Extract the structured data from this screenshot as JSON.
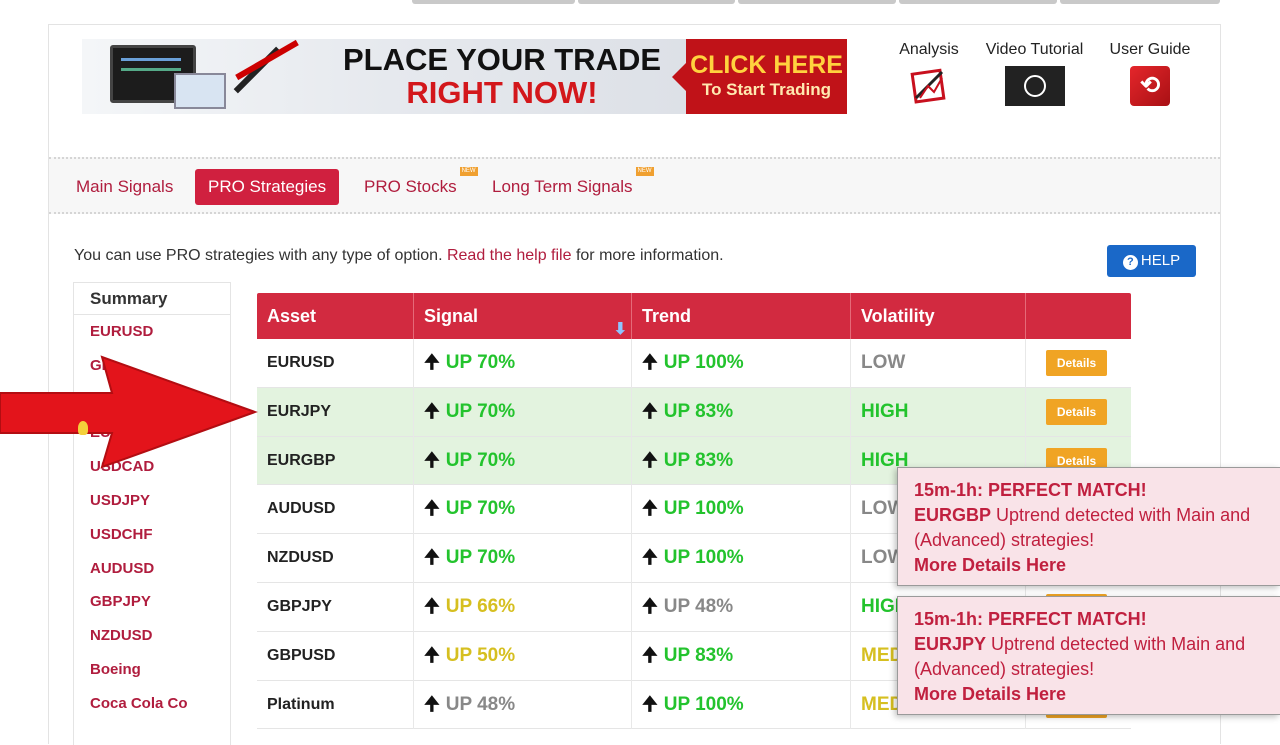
{
  "banner": {
    "headline_1": "PLACE YOUR TRADE",
    "headline_2": "RIGHT NOW!",
    "cta_1": "CLICK HERE",
    "cta_2": "To Start Trading"
  },
  "tools": {
    "analysis": "Analysis",
    "video": "Video Tutorial",
    "guide": "User Guide"
  },
  "tabs": [
    {
      "label": "Main Signals",
      "new": ""
    },
    {
      "label": "PRO Strategies",
      "new": ""
    },
    {
      "label": "PRO Stocks",
      "new": "NEW"
    },
    {
      "label": "Long Term Signals",
      "new": "NEW"
    }
  ],
  "info": {
    "text_before": "You can use PRO strategies with any type of option. ",
    "link": "Read the help file",
    "text_after": " for more information."
  },
  "help_label": "HELP",
  "sidebar": {
    "summary": "Summary",
    "items": [
      "EURUSD",
      "GB",
      "",
      "EUR",
      "USDCAD",
      "USDJPY",
      "USDCHF",
      "AUDUSD",
      "GBPJPY",
      "NZDUSD",
      "Boeing",
      "Coca Cola Co"
    ]
  },
  "table": {
    "headers": [
      "Asset",
      "Signal",
      "Trend",
      "Volatility",
      ""
    ],
    "details_label": "Details",
    "rows": [
      {
        "asset": "EURUSD",
        "signal": "UP 70%",
        "signal_color": "green",
        "trend": "UP 100%",
        "trend_color": "green",
        "vol": "LOW",
        "vol_color": "grey",
        "highlight": false
      },
      {
        "asset": "EURJPY",
        "signal": "UP 70%",
        "signal_color": "green",
        "trend": "UP 83%",
        "trend_color": "green",
        "vol": "HIGH",
        "vol_color": "green",
        "highlight": true
      },
      {
        "asset": "EURGBP",
        "signal": "UP 70%",
        "signal_color": "green",
        "trend": "UP 83%",
        "trend_color": "green",
        "vol": "HIGH",
        "vol_color": "green",
        "highlight": true
      },
      {
        "asset": "AUDUSD",
        "signal": "UP 70%",
        "signal_color": "green",
        "trend": "UP 100%",
        "trend_color": "green",
        "vol": "LOW",
        "vol_color": "grey",
        "highlight": false
      },
      {
        "asset": "NZDUSD",
        "signal": "UP 70%",
        "signal_color": "green",
        "trend": "UP 100%",
        "trend_color": "green",
        "vol": "LOW",
        "vol_color": "grey",
        "highlight": false
      },
      {
        "asset": "GBPJPY",
        "signal": "UP 66%",
        "signal_color": "yellow",
        "trend": "UP 48%",
        "trend_color": "grey",
        "vol": "HIGH",
        "vol_color": "green",
        "highlight": false
      },
      {
        "asset": "GBPUSD",
        "signal": "UP 50%",
        "signal_color": "yellow",
        "trend": "UP 83%",
        "trend_color": "green",
        "vol": "MEDIUM",
        "vol_color": "yellow",
        "highlight": false
      },
      {
        "asset": "Platinum",
        "signal": "UP 48%",
        "signal_color": "grey",
        "trend": "UP 100%",
        "trend_color": "green",
        "vol": "MEDIUM",
        "vol_color": "yellow",
        "highlight": false
      }
    ]
  },
  "toasts": [
    {
      "title": "15m-1h: PERFECT MATCH!",
      "pair": "EURGBP",
      "text1": " Uptrend detected with Main and",
      "text2": "(Advanced) strategies!",
      "link": "More Details Here"
    },
    {
      "title": "15m-1h: PERFECT MATCH!",
      "pair": "EURJPY",
      "text1": " Uptrend detected with Main and",
      "text2": "(Advanced) strategies!",
      "link": "More Details Here"
    }
  ],
  "colors": {
    "accent": "#d22a40",
    "green": "#23c32d",
    "yellow": "#d6bf20",
    "grey": "#888888",
    "help": "#1a68c8",
    "details": "#f0a424"
  }
}
